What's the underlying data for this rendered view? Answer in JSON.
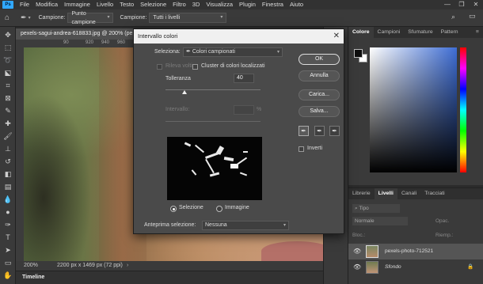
{
  "menubar": {
    "items": [
      "File",
      "Modifica",
      "Immagine",
      "Livello",
      "Testo",
      "Selezione",
      "Filtro",
      "3D",
      "Visualizza",
      "Plugin",
      "Finestra",
      "Aiuto"
    ]
  },
  "options": {
    "sample_label": "Campione:",
    "sample_value": "Punto campione",
    "sample2_label": "Campione:",
    "sample2_value": "Tutti i livelli"
  },
  "document": {
    "tab_title": "pexels-sagui-andrea-618833.jpg @ 200% (pe",
    "zoom": "200%",
    "size_info": "2200 px x 1469 px (72 ppi)",
    "ruler_ticks": [
      "90",
      "920",
      "940",
      "960",
      "980"
    ]
  },
  "timeline": {
    "label": "Timeline"
  },
  "color_panel": {
    "tabs": [
      "Colore",
      "Campioni",
      "Sfumature",
      "Pattern"
    ],
    "colors": {
      "foreground": "#0d0d0d",
      "background": "#ffffff",
      "sv_hue": "#3e6dd4"
    }
  },
  "layers_panel": {
    "tabs": [
      "Librerie",
      "Livelli",
      "Canali",
      "Tracciati"
    ],
    "search_placeholder": "Tipo",
    "blend_mode": "Normale",
    "opacity_label": "Opac.",
    "lock_label": "Bloc.:",
    "fill_label": "Riemp.:",
    "layers": [
      {
        "name": "pexels-photo-712521"
      },
      {
        "name": "Sfondo"
      }
    ]
  },
  "dialog": {
    "title": "Intervallo colori",
    "close": "✕",
    "select_label": "Seleziona:",
    "select_value": "Colori campionati",
    "detect_faces": "Rileva volti",
    "localized_clusters": "Cluster di colori localizzati",
    "tolerance_label": "Tolleranza",
    "tolerance_value": "40",
    "tolerance_fraction": 0.2,
    "range_label": "Intervallo:",
    "range_unit": "%",
    "radio_selection": "Selezione",
    "radio_image": "Immagine",
    "preview_label": "Anteprima selezione:",
    "preview_value": "Nessuna",
    "buttons": {
      "ok": "OK",
      "reset": "Annulla",
      "load": "Carica...",
      "save": "Salva..."
    },
    "invert": "Inverti"
  }
}
